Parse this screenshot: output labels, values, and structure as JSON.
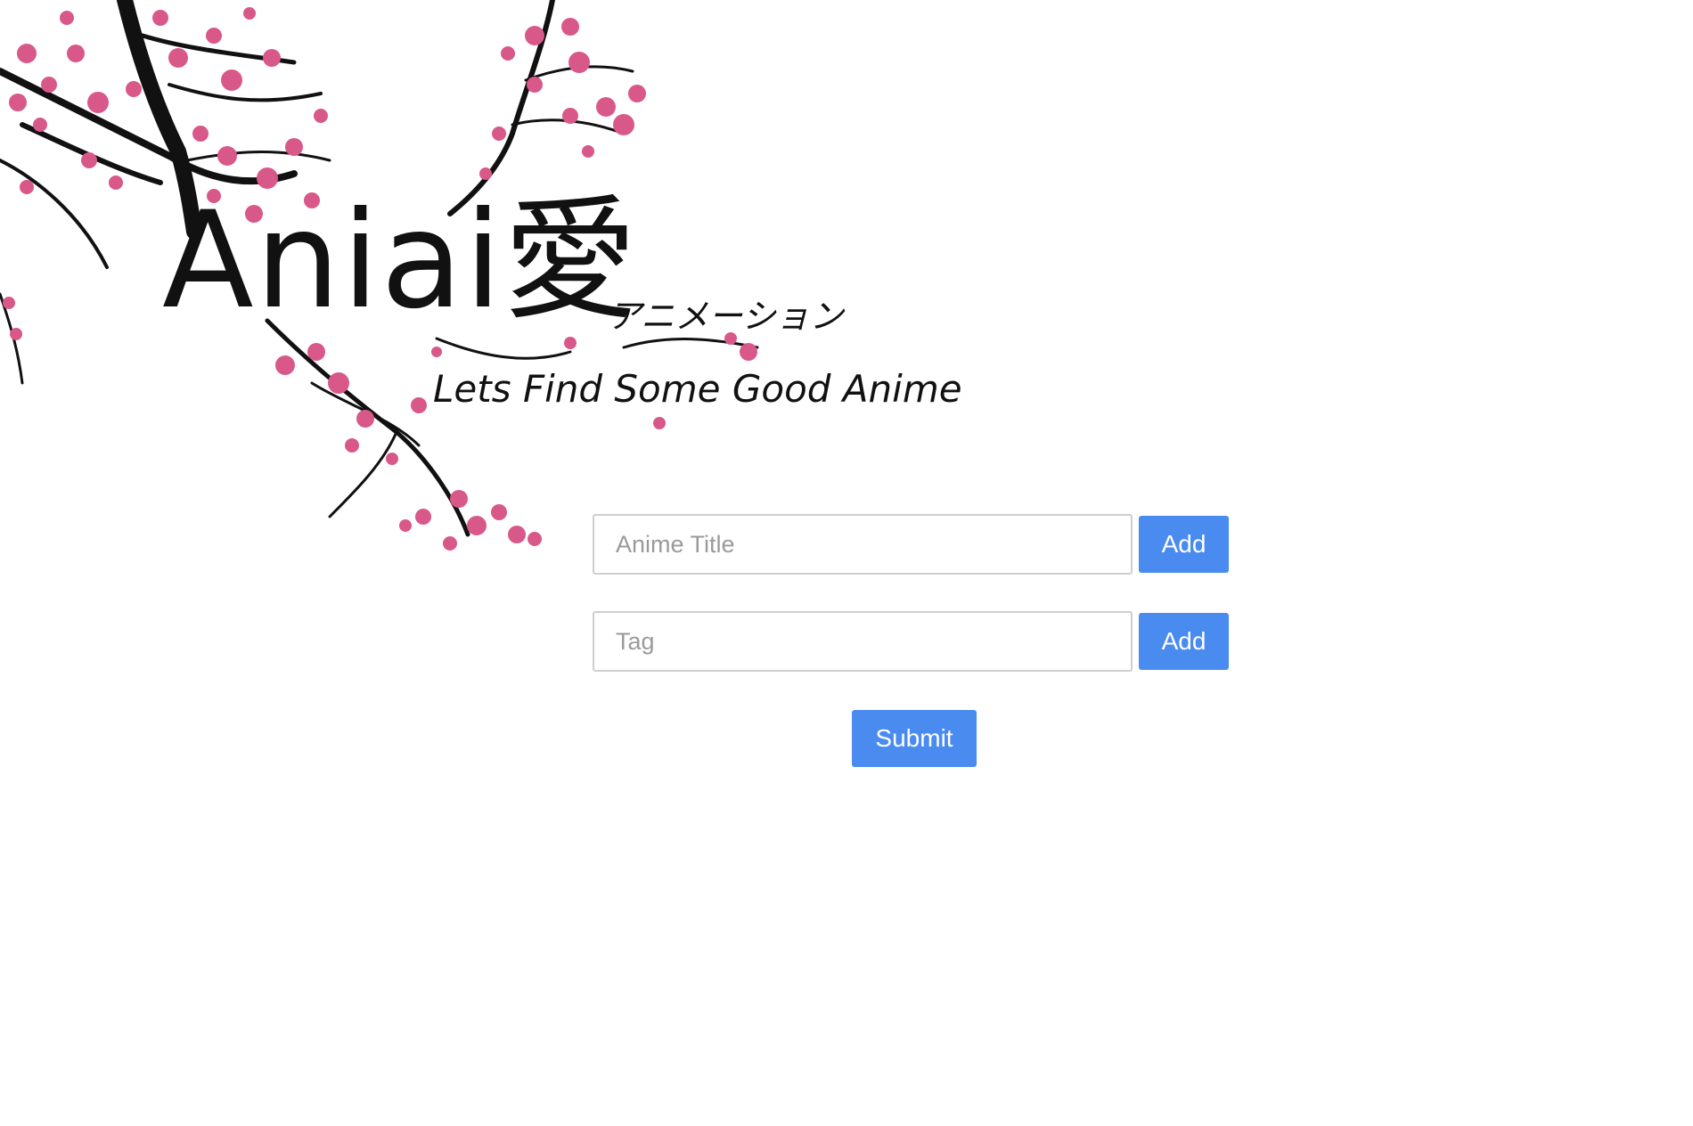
{
  "header": {
    "logo_text": "Aniai愛",
    "logo_subtitle": "アニメーション",
    "tagline": "Lets Find Some Good Anime"
  },
  "form": {
    "title_field": {
      "placeholder": "Anime Title",
      "value": ""
    },
    "title_add_label": "Add",
    "tag_field": {
      "placeholder": "Tag",
      "value": ""
    },
    "tag_add_label": "Add",
    "submit_label": "Submit"
  },
  "colors": {
    "button_blue": "#4a8bf0",
    "blossom_pink": "#d9588a",
    "branch_black": "#111111"
  },
  "decor": {
    "illustration": "cherry-blossom-branches"
  }
}
